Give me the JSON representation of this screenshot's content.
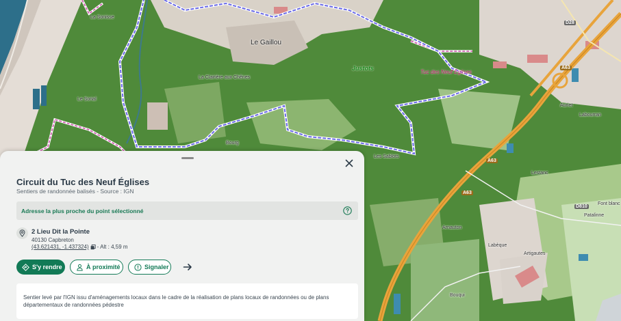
{
  "map": {
    "labels": {
      "le_gaillou": "Le Gaillou",
      "justots": "Justots",
      "tuc_des_neuf_eglises": "Tuc des Neuf Églises",
      "la_clairiere": "La Clairière aux Chênes",
      "la_sonisse": "La Sonisse",
      "le_sorial": "Le Sorial",
      "auriet": "Auriet",
      "labourran": "Labourran",
      "lestanc": "Lestanc",
      "font_blanc": "Font blanc",
      "arnauton": "Arnauton",
      "labeque": "Labèque",
      "artigaut": "Artigautes",
      "bouqui": "Bouqui",
      "patalinne": "Patalinne",
      "les_sablots": "Les Sablots",
      "bourg": "Bourg"
    },
    "roads": {
      "a63_a": "A63",
      "a63_b": "A63",
      "a63_c": "A63",
      "d28": "D28",
      "d810": "D810"
    },
    "colors": {
      "forest": "#4f8a3a",
      "forest_dark": "#3c7530",
      "meadow": "#a8c98b",
      "urban": "#e8e0dc",
      "sea": "#2d6f8a",
      "highway": "#e8a43c",
      "trail": "#6a6ae8",
      "regional_trail": "#d060b0"
    }
  },
  "panel": {
    "title": "Circuit du Tuc des Neuf Églises",
    "subtitle": "Sentiers de randonnée balisés - Source : IGN",
    "address_bar_label": "Adresse la plus proche du point sélectionné",
    "address": {
      "line1": "2 Lieu Dit la Pointe",
      "line2": "40130 Capbreton",
      "coords": "(43.621431, -1.437324)",
      "alt": "- Alt : 4,59 m"
    },
    "buttons": {
      "go": "S'y rendre",
      "nearby": "À proximité",
      "report": "Signaler"
    },
    "description": "Sentier levé par l'IGN issu d'aménagements locaux dans le cadre de la réalisation de plans locaux de randonnées ou de plans départementaux de randonnées pédestre"
  },
  "icons": {
    "close": "close-icon",
    "help": "help-icon",
    "pin": "map-pin-icon",
    "copy": "copy-icon",
    "navigate": "navigation-icon",
    "person": "person-icon",
    "alert": "alert-icon",
    "arrow": "arrow-right-icon"
  }
}
